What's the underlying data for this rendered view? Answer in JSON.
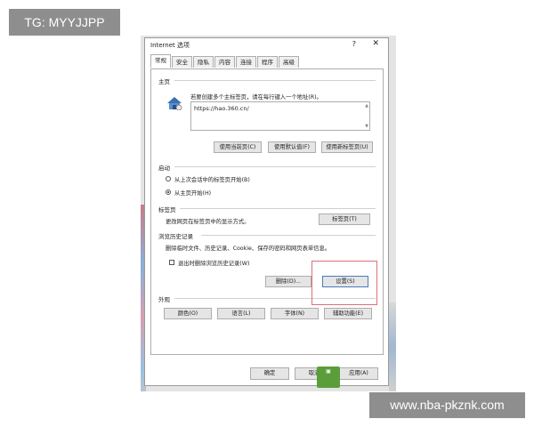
{
  "tags": {
    "top": "TG: MYYJJPP",
    "bottom": "www.nba-pkznk.com"
  },
  "dialog": {
    "title": "Internet 选项",
    "help": "?",
    "close": "✕",
    "tabs": [
      "常规",
      "安全",
      "隐私",
      "内容",
      "连接",
      "程序",
      "高级"
    ],
    "homepage": {
      "section": "主页",
      "desc": "若要创建多个主标签页，请在每行键入一个地址(R)。",
      "url": "https://hao.360.cn/",
      "btn_current": "使用当前页(C)",
      "btn_default": "使用默认值(F)",
      "btn_newtab": "使用新标签页(U)"
    },
    "startup": {
      "section": "启动",
      "opt_last": "从上次会话中的标签页开始(B)",
      "opt_home": "从主页开始(H)"
    },
    "tabs_section": {
      "section": "标签页",
      "desc": "更改网页在标签页中的显示方式。",
      "btn": "标签页(T)"
    },
    "history": {
      "section": "浏览历史记录",
      "desc": "删除临时文件、历史记录、Cookie、保存的密码和网页表单信息。",
      "checkbox": "退出时删除浏览历史记录(W)",
      "btn_delete": "删除(D)...",
      "btn_settings": "设置(S)"
    },
    "appearance": {
      "section": "外观",
      "btn_colors": "颜色(O)",
      "btn_languages": "语言(L)",
      "btn_fonts": "字体(N)",
      "btn_accessibility": "辅助功能(E)"
    },
    "footer": {
      "ok": "确定",
      "cancel": "取消",
      "apply": "应用(A)"
    }
  },
  "colors": {
    "highlight_border": "#d9707a",
    "tag_background": "#8e8e8e"
  }
}
